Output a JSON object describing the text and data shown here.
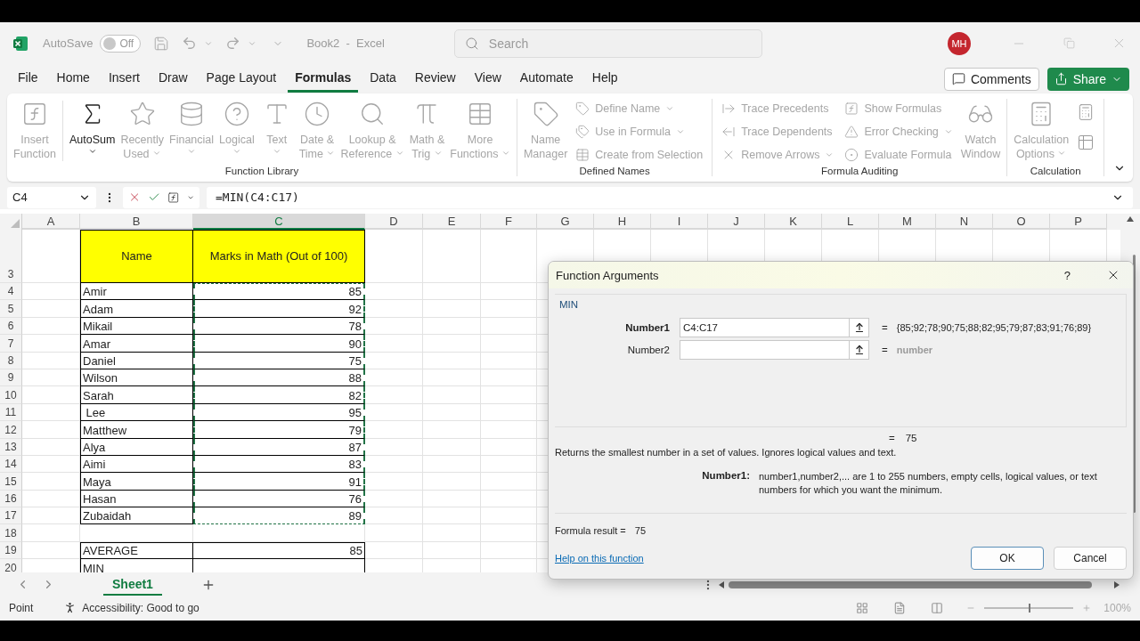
{
  "title_bar": {
    "autosave": {
      "label": "AutoSave",
      "state": "Off",
      "on": false
    },
    "document": "Book2  -  Excel",
    "search": {
      "placeholder": "Search"
    },
    "account": "MH"
  },
  "menu": [
    {
      "label": "File",
      "selected": false
    },
    {
      "label": "Home",
      "selected": false
    },
    {
      "label": "Insert",
      "selected": false
    },
    {
      "label": "Draw",
      "selected": false
    },
    {
      "label": "Page Layout",
      "selected": false
    },
    {
      "label": "Formulas",
      "selected": true
    },
    {
      "label": "Data",
      "selected": false
    },
    {
      "label": "Review",
      "selected": false
    },
    {
      "label": "View",
      "selected": false
    },
    {
      "label": "Automate",
      "selected": false
    },
    {
      "label": "Help",
      "selected": false
    }
  ],
  "actions": {
    "comments": "Comments",
    "share": "Share"
  },
  "ribbon": [
    {
      "title": "Function Library",
      "items": [
        {
          "kind": "large",
          "lines": [
            "Insert",
            "Function"
          ],
          "disabled": true,
          "dropdown": false
        },
        {
          "kind": "large",
          "lines": [
            "AutoSum"
          ],
          "disabled": false,
          "dropdown": true
        },
        {
          "kind": "large",
          "lines": [
            "Recently",
            "Used"
          ],
          "disabled": true,
          "dropdown": true
        },
        {
          "kind": "large",
          "lines": [
            "Financial"
          ],
          "disabled": true,
          "dropdown": true
        },
        {
          "kind": "large",
          "lines": [
            "Logical"
          ],
          "disabled": true,
          "dropdown": true
        },
        {
          "kind": "large",
          "lines": [
            "Text"
          ],
          "disabled": true,
          "dropdown": true
        },
        {
          "kind": "large",
          "lines": [
            "Date &",
            "Time"
          ],
          "disabled": true,
          "dropdown": true
        },
        {
          "kind": "large",
          "lines": [
            "Lookup &",
            "Reference"
          ],
          "disabled": true,
          "dropdown": true
        },
        {
          "kind": "large",
          "lines": [
            "Math &",
            "Trig"
          ],
          "disabled": true,
          "dropdown": true
        },
        {
          "kind": "large",
          "lines": [
            "More",
            "Functions"
          ],
          "disabled": true,
          "dropdown": true
        }
      ]
    },
    {
      "title": "Defined Names",
      "items": [
        {
          "kind": "large",
          "lines": [
            "Name",
            "Manager"
          ],
          "disabled": true,
          "dropdown": false
        },
        {
          "kind": "small",
          "lines": [
            "Define Name"
          ],
          "disabled": true,
          "dropdown": true
        },
        {
          "kind": "small",
          "lines": [
            "Use in Formula"
          ],
          "disabled": true,
          "dropdown": true
        },
        {
          "kind": "small",
          "lines": [
            "Create from Selection"
          ],
          "disabled": true,
          "dropdown": false
        }
      ]
    },
    {
      "title": "Formula Auditing",
      "items": [
        {
          "kind": "small",
          "lines": [
            "Trace Precedents"
          ],
          "disabled": true,
          "dropdown": false
        },
        {
          "kind": "small",
          "lines": [
            "Trace Dependents"
          ],
          "disabled": true,
          "dropdown": false
        },
        {
          "kind": "small",
          "lines": [
            "Remove Arrows"
          ],
          "disabled": true,
          "dropdown": true
        },
        {
          "kind": "small",
          "lines": [
            "Show Formulas"
          ],
          "disabled": true,
          "dropdown": false
        },
        {
          "kind": "small",
          "lines": [
            "Error Checking"
          ],
          "disabled": true,
          "dropdown": true
        },
        {
          "kind": "small",
          "lines": [
            "Evaluate Formula"
          ],
          "disabled": true,
          "dropdown": false
        },
        {
          "kind": "large",
          "lines": [
            "Watch",
            "Window"
          ],
          "disabled": true,
          "dropdown": false
        }
      ]
    },
    {
      "title": "Calculation",
      "items": [
        {
          "kind": "large",
          "lines": [
            "Calculation",
            "Options"
          ],
          "disabled": true,
          "dropdown": true
        },
        {
          "kind": "icon",
          "disabled": true
        },
        {
          "kind": "icon",
          "disabled": true
        }
      ]
    }
  ],
  "formula_bar": {
    "name_box": "C4",
    "formula": "=MIN(C4:C17)"
  },
  "sheet": {
    "columns": [
      {
        "label": "A",
        "selected": false
      },
      {
        "label": "B",
        "selected": false
      },
      {
        "label": "C",
        "selected": true
      },
      {
        "label": "D",
        "selected": false
      },
      {
        "label": "E",
        "selected": false
      },
      {
        "label": "F",
        "selected": false
      },
      {
        "label": "G",
        "selected": false
      },
      {
        "label": "H",
        "selected": false
      },
      {
        "label": "I",
        "selected": false
      },
      {
        "label": "J",
        "selected": false
      },
      {
        "label": "K",
        "selected": false
      },
      {
        "label": "L",
        "selected": false
      },
      {
        "label": "M",
        "selected": false
      },
      {
        "label": "N",
        "selected": false
      },
      {
        "label": "O",
        "selected": false
      },
      {
        "label": "P",
        "selected": false
      }
    ],
    "rows": [
      {
        "number": "3",
        "kind": "header",
        "cells": [
          "Name",
          "Marks in Math (Out of 100)"
        ]
      },
      {
        "number": "4",
        "kind": "data",
        "cells": [
          "Amir",
          "85"
        ],
        "in_range": true
      },
      {
        "number": "5",
        "kind": "data",
        "cells": [
          "Adam",
          "92"
        ],
        "in_range": true
      },
      {
        "number": "6",
        "kind": "data",
        "cells": [
          "Mikail",
          "78"
        ],
        "in_range": true
      },
      {
        "number": "7",
        "kind": "data",
        "cells": [
          "Amar",
          "90"
        ],
        "in_range": true
      },
      {
        "number": "8",
        "kind": "data",
        "cells": [
          "Daniel",
          "75"
        ],
        "in_range": true
      },
      {
        "number": "9",
        "kind": "data",
        "cells": [
          "Wilson",
          "88"
        ],
        "in_range": true
      },
      {
        "number": "10",
        "kind": "data",
        "cells": [
          "Sarah",
          "82"
        ],
        "in_range": true
      },
      {
        "number": "11",
        "kind": "data",
        "cells": [
          " Lee",
          "95"
        ],
        "in_range": true
      },
      {
        "number": "12",
        "kind": "data",
        "cells": [
          "Matthew",
          "79"
        ],
        "in_range": true
      },
      {
        "number": "13",
        "kind": "data",
        "cells": [
          "Alya",
          "87"
        ],
        "in_range": true
      },
      {
        "number": "14",
        "kind": "data",
        "cells": [
          "Aimi",
          "83"
        ],
        "in_range": true
      },
      {
        "number": "15",
        "kind": "data",
        "cells": [
          "Maya",
          "91"
        ],
        "in_range": true
      },
      {
        "number": "16",
        "kind": "data",
        "cells": [
          "Hasan",
          "76"
        ],
        "in_range": true
      },
      {
        "number": "17",
        "kind": "data",
        "cells": [
          "Zubaidah",
          "89"
        ],
        "in_range": true
      },
      {
        "number": "18",
        "kind": "blank"
      },
      {
        "number": "19",
        "kind": "data",
        "cells": [
          "AVERAGE",
          "85"
        ],
        "in_range": false
      },
      {
        "number": "20",
        "kind": "data",
        "cells": [
          "MIN"
        ],
        "in_range": false
      }
    ]
  },
  "dialog": {
    "title": "Function Arguments",
    "help": "?",
    "function": "MIN",
    "arguments": [
      {
        "label": "Number1",
        "value": "C4:C17",
        "sign": "=",
        "result": "{85;92;78;90;75;88;82;95;79;87;83;91;76;89}",
        "selected": true,
        "result_is_hint": false
      },
      {
        "label": "Number2",
        "sign": "=",
        "result": "number",
        "selected": false,
        "result_is_hint": true
      }
    ],
    "total": {
      "sign": "=",
      "value": "75"
    },
    "description": "Returns the smallest number in a set of values. Ignores logical values and text.",
    "argument_help": {
      "label": "Number1:",
      "text": "number1,number2,... are 1 to 255 numbers, empty cells, logical values, or text numbers for which you want the minimum."
    },
    "formula_result": {
      "label": "Formula result =",
      "value": "75"
    },
    "link": "Help on this function",
    "buttons": [
      "OK",
      "Cancel"
    ]
  },
  "sheet_tabs": [
    {
      "label": "Sheet1",
      "selected": true
    }
  ],
  "status_bar": {
    "mode": "Point",
    "accessibility": "Accessibility: Good to go",
    "zoom": {
      "level": 0.5,
      "reading": "100%"
    }
  }
}
